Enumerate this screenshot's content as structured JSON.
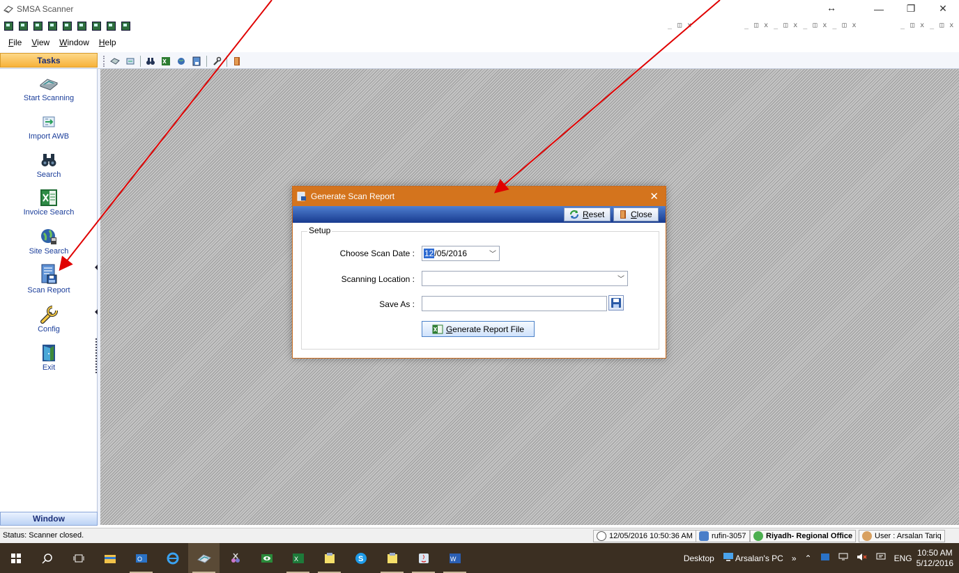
{
  "window": {
    "title": "SMSA Scanner",
    "resize_indicator": "↔",
    "controls": {
      "minimize": "—",
      "maximize": "❐",
      "close": "✕"
    }
  },
  "mdi": {
    "ctrl1": "_ ◫ x",
    "ctrl2": "_ ◫ x _ ◫ x _ ◫ x _ ◫ x",
    "ctrl3": "_ ◫ x _ ◫ x"
  },
  "menu": {
    "items": [
      "File",
      "View",
      "Window",
      "Help"
    ]
  },
  "tasks": {
    "header": "Tasks",
    "items": [
      {
        "label": "Start Scanning",
        "icon": "scanner-icon"
      },
      {
        "label": "Import AWB",
        "icon": "import-icon"
      },
      {
        "label": "Search",
        "icon": "binoculars-icon"
      },
      {
        "label": "Invoice Search",
        "icon": "excel-icon"
      },
      {
        "label": "Site Search",
        "icon": "globe-icon"
      },
      {
        "label": "Scan Report",
        "icon": "report-icon"
      },
      {
        "label": "Config",
        "icon": "wrench-icon"
      },
      {
        "label": "Exit",
        "icon": "exit-door-icon"
      }
    ]
  },
  "window_panel": {
    "header": "Window"
  },
  "dialog": {
    "title": "Generate Scan Report",
    "close_glyph": "✕",
    "toolbar": {
      "reset_label": "Reset",
      "close_label": "Close"
    },
    "group_label": "Setup",
    "fields": {
      "scan_date_label": "Choose Scan Date :",
      "scan_date_selected": "12",
      "scan_date_rest": "/05/2016",
      "location_label": "Scanning Location :",
      "location_value": "",
      "save_as_label": "Save As :",
      "save_as_value": ""
    },
    "generate_label": "Generate Report File"
  },
  "status": {
    "text": "Status: Scanner closed.",
    "datetime": "12/05/2016 10:50:36 AM",
    "machine": "rufin-3057",
    "office": "Riyadh- Regional Office",
    "user": "User : Arsalan Tariq"
  },
  "taskbar": {
    "desktop_label": "Desktop",
    "pc_label": "Arsalan's PC",
    "overflow": "»",
    "lang": "ENG",
    "time": "10:50 AM",
    "date": "5/12/2016"
  },
  "colors": {
    "tasks_header": "#f7b23a",
    "dialog_title": "#d4741d",
    "dialog_toolbar": "#183b8f",
    "taskbar": "#3b2f22",
    "annotation_arrow": "#e00000"
  }
}
